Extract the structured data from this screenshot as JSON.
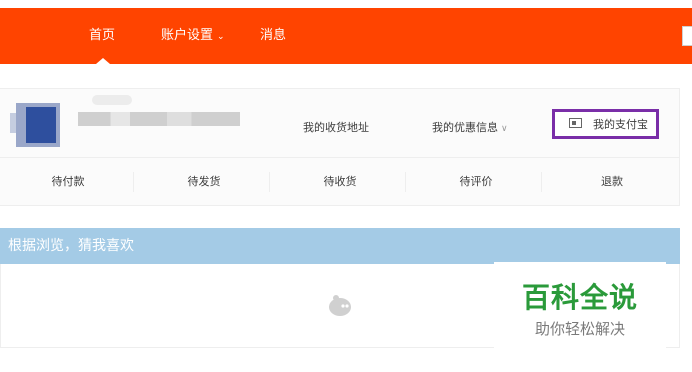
{
  "topnav": {
    "home_label": "首页",
    "account_label": "账户设置",
    "messages_label": "消息"
  },
  "profile": {
    "links": {
      "address_label": "我的收货地址",
      "coupon_label": "我的优惠信息",
      "alipay_label": "我的支付宝"
    }
  },
  "orders": {
    "items": [
      "待付款",
      "待发货",
      "待收货",
      "待评价",
      "退款"
    ]
  },
  "guess": {
    "title": "根据浏览，猜我喜欢"
  },
  "watermark": {
    "title": "百科全说",
    "subtitle": "助你轻松解决"
  },
  "colors": {
    "topbar": "#ff4400",
    "guess_bar": "#a4cbe6",
    "highlight_border": "#7a2ea8",
    "watermark_green": "#2a9a3a"
  },
  "icons": {
    "account_dropdown": "chevron-down-icon",
    "coupon_dropdown": "chevron-down-icon",
    "alipay": "card-icon",
    "loading": "mascot-icon"
  }
}
